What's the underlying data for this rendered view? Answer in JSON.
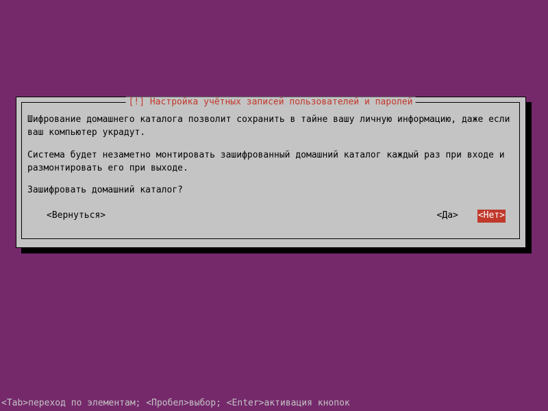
{
  "dialog": {
    "title_marker": "[!]",
    "title": "Настройка учётных записей пользователей и паролей",
    "paragraph1": "Шифрование домашнего каталога позволит сохранить в тайне вашу личную информацию, даже если ваш компьютер украдут.",
    "paragraph2": "Система будет незаметно монтировать зашифрованный домашний каталог каждый раз при входе и размонтировать его при выходе.",
    "question": "Зашифровать домашний каталог?",
    "buttons": {
      "back": "<Вернуться>",
      "yes": "<Да>",
      "no": "<Нет>"
    }
  },
  "footer": {
    "hint": "<Tab>переход по элементам; <Пробел>выбор; <Enter>активация кнопок"
  },
  "colors": {
    "background": "#75296b",
    "dialog_bg": "#c4c4c4",
    "accent": "#c0392b"
  }
}
